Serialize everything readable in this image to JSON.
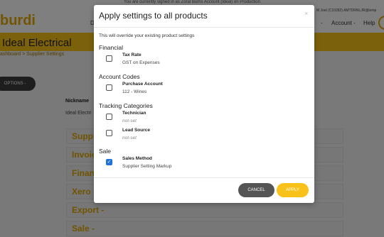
{
  "background": {
    "banner": "You are currently signed in as Zoral Burns Account (Ideal) on Production",
    "logo": "burdi",
    "nav_d": "D",
    "user_info": "M Joel (C10282) AMTDRNLJR@lemp",
    "nav_caret": "-",
    "nav_account": "Account -",
    "nav_help": "Help",
    "avatar": "I",
    "header_title": "Ideal Electrical",
    "breadcrumb": "ashboard > Supplier Settings",
    "options_button": "OPTIONS -",
    "nickname_label": "Nickname",
    "nickname_value": "Ideal Electri",
    "sections": [
      "Suppli",
      "Invoic",
      "Financ",
      "Xero -",
      "Export -",
      "Sale -"
    ]
  },
  "modal": {
    "title": "Apply settings to all products",
    "close_glyph": "×",
    "description": "This will override your existing product settings",
    "groups": [
      {
        "title": "Financial",
        "items": [
          {
            "label": "Tax Rate",
            "value": "GST on Expenses",
            "checked": false
          }
        ]
      },
      {
        "title": "Account Codes",
        "items": [
          {
            "label": "Purchase Account",
            "value": "112 - Wines",
            "checked": false
          }
        ]
      },
      {
        "title": "Tracking Categories",
        "items": [
          {
            "label": "Technician",
            "value": "not-set",
            "checked": false
          },
          {
            "label": "Lead Source",
            "value": "not-set",
            "checked": false
          }
        ]
      },
      {
        "title": "Sale",
        "items": [
          {
            "label": "Sales Method",
            "value": "Supplier Setting Markup",
            "checked": true
          }
        ]
      }
    ],
    "cancel_label": "CANCEL",
    "apply_label": "APPLY"
  }
}
